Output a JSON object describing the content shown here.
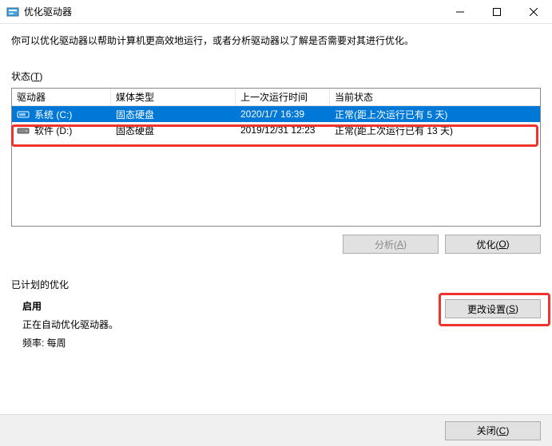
{
  "window": {
    "title": "优化驱动器"
  },
  "description": "你可以优化驱动器以帮助计算机更高效地运行，或者分析驱动器以了解是否需要对其进行优化。",
  "statusLabel": {
    "text": "状态(",
    "key": "T",
    "suffix": ")"
  },
  "columns": {
    "drive": "驱动器",
    "media": "媒体类型",
    "last": "上一次运行时间",
    "status": "当前状态"
  },
  "drives": [
    {
      "name": "系统 (C:)",
      "media": "固态硬盘",
      "last": "2020/1/7 16:39",
      "status": "正常(距上次运行已有 5 天)",
      "selected": true
    },
    {
      "name": "软件 (D:)",
      "media": "固态硬盘",
      "last": "2019/12/31 12:23",
      "status": "正常(距上次运行已有 13 天)",
      "selected": false
    }
  ],
  "buttons": {
    "analyze": {
      "text": "分析(",
      "key": "A",
      "suffix": ")"
    },
    "optimize": {
      "text": "优化(",
      "key": "O",
      "suffix": ")"
    },
    "change": {
      "text": "更改设置(",
      "key": "S",
      "suffix": ")"
    },
    "close": {
      "text": "关闭(",
      "key": "C",
      "suffix": ")"
    }
  },
  "schedule": {
    "label": "已计划的优化",
    "status": "启用",
    "desc": "正在自动优化驱动器。",
    "freq": "频率: 每周"
  }
}
